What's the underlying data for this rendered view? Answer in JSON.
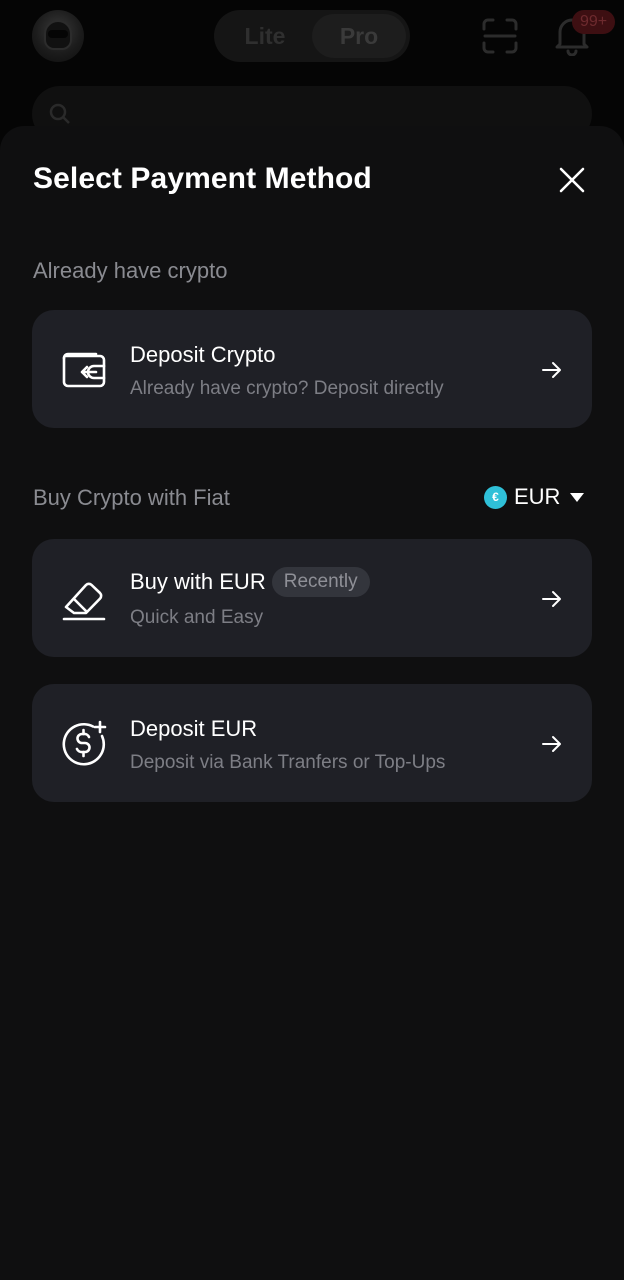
{
  "background_app": {
    "mode_toggle": {
      "options": [
        "Lite",
        "Pro"
      ],
      "selected": "Pro"
    },
    "notifications_badge": "99+"
  },
  "sheet": {
    "title": "Select Payment Method",
    "section_crypto": {
      "label": "Already have crypto",
      "items": [
        {
          "title": "Deposit Crypto",
          "subtitle": "Already have crypto? Deposit directly",
          "icon": "wallet-deposit-icon"
        }
      ]
    },
    "section_fiat": {
      "label": "Buy Crypto with Fiat",
      "currency": {
        "symbol": "€",
        "code": "EUR",
        "color": "#2fc0d8"
      },
      "items": [
        {
          "title": "Buy with EUR",
          "badge": "Recently",
          "subtitle": "Quick and Easy",
          "icon": "card-eraser-icon"
        },
        {
          "title": "Deposit EUR",
          "subtitle": "Deposit via Bank Tranfers or Top-Ups",
          "icon": "dollar-plus-icon"
        }
      ]
    }
  },
  "colors": {
    "sheet_background": "#0f0f10",
    "card_background": "#1f2026",
    "secondary_text": "#8a8b91",
    "accent_currency": "#2fc0d8"
  }
}
